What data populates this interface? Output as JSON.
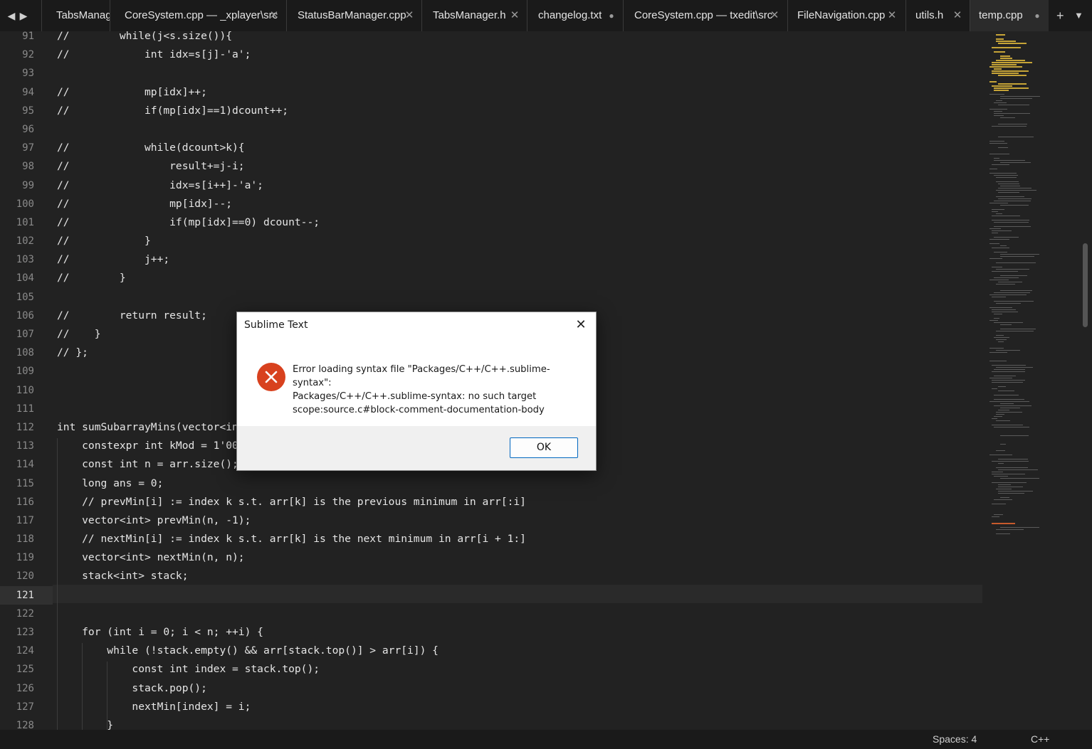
{
  "tabbar": {
    "back_icon": "◀",
    "forward_icon": "▶",
    "tabs": [
      {
        "label": "TabsManager",
        "state": "close"
      },
      {
        "label": "CoreSystem.cpp — _xplayer\\src",
        "state": "close"
      },
      {
        "label": "StatusBarManager.cpp",
        "state": "close"
      },
      {
        "label": "TabsManager.h",
        "state": "close"
      },
      {
        "label": "changelog.txt",
        "state": "dirty"
      },
      {
        "label": "CoreSystem.cpp — txedit\\src",
        "state": "close"
      },
      {
        "label": "FileNavigation.cpp",
        "state": "close"
      },
      {
        "label": "utils.h",
        "state": "close"
      },
      {
        "label": "temp.cpp",
        "state": "dirty",
        "active": true
      }
    ],
    "close_glyph": "✕",
    "dirty_glyph": "●",
    "new_tab_icon": "+",
    "tab_list_icon": "▼"
  },
  "editor": {
    "current_line": 121,
    "lines": [
      {
        "n": 91,
        "text": "//        while(j<s.size()){"
      },
      {
        "n": 92,
        "text": "//            int idx=s[j]-'a';"
      },
      {
        "n": 93,
        "text": ""
      },
      {
        "n": 94,
        "text": "//            mp[idx]++;"
      },
      {
        "n": 95,
        "text": "//            if(mp[idx]==1)dcount++;"
      },
      {
        "n": 96,
        "text": ""
      },
      {
        "n": 97,
        "text": "//            while(dcount>k){"
      },
      {
        "n": 98,
        "text": "//                result+=j-i;"
      },
      {
        "n": 99,
        "text": "//                idx=s[i++]-'a';"
      },
      {
        "n": 100,
        "text": "//                mp[idx]--;"
      },
      {
        "n": 101,
        "text": "//                if(mp[idx]==0) dcount--;"
      },
      {
        "n": 102,
        "text": "//            }"
      },
      {
        "n": 103,
        "text": "//            j++;"
      },
      {
        "n": 104,
        "text": "//        }"
      },
      {
        "n": 105,
        "text": ""
      },
      {
        "n": 106,
        "text": "//        return result;"
      },
      {
        "n": 107,
        "text": "//    }"
      },
      {
        "n": 108,
        "text": "// };"
      },
      {
        "n": 109,
        "text": ""
      },
      {
        "n": 110,
        "text": ""
      },
      {
        "n": 111,
        "text": ""
      },
      {
        "n": 112,
        "text": "int sumSubarrayMins(vector<int>& arr) {"
      },
      {
        "n": 113,
        "text": "    constexpr int kMod = 1'000'000'007;"
      },
      {
        "n": 114,
        "text": "    const int n = arr.size();"
      },
      {
        "n": 115,
        "text": "    long ans = 0;"
      },
      {
        "n": 116,
        "text": "    // prevMin[i] := index k s.t. arr[k] is the previous minimum in arr[:i]"
      },
      {
        "n": 117,
        "text": "    vector<int> prevMin(n, -1);"
      },
      {
        "n": 118,
        "text": "    // nextMin[i] := index k s.t. arr[k] is the next minimum in arr[i + 1:]"
      },
      {
        "n": 119,
        "text": "    vector<int> nextMin(n, n);"
      },
      {
        "n": 120,
        "text": "    stack<int> stack;"
      },
      {
        "n": 121,
        "text": ""
      },
      {
        "n": 122,
        "text": ""
      },
      {
        "n": 123,
        "text": "    for (int i = 0; i < n; ++i) {"
      },
      {
        "n": 124,
        "text": "        while (!stack.empty() && arr[stack.top()] > arr[i]) {"
      },
      {
        "n": 125,
        "text": "            const int index = stack.top();"
      },
      {
        "n": 126,
        "text": "            stack.pop();"
      },
      {
        "n": 127,
        "text": "            nextMin[index] = i;"
      },
      {
        "n": 128,
        "text": "        }"
      }
    ]
  },
  "dialog": {
    "title": "Sublime Text",
    "close_glyph": "✕",
    "icon": "error-icon",
    "message_lines": [
      "Error loading syntax file \"Packages/C++/C++.sublime-syntax\":",
      "Packages/C++/C++.sublime-syntax: no such target",
      "scope:source.c#block-comment-documentation-body"
    ],
    "ok_label": "OK"
  },
  "statusbar": {
    "spaces": "Spaces: 4",
    "syntax": "C++"
  },
  "colors": {
    "editor_bg": "#222222",
    "tabbar_bg": "#1a1a1a",
    "error_red": "#d8411e",
    "ok_border": "#0067c0",
    "minimap_yellow": "#d8b23a"
  }
}
